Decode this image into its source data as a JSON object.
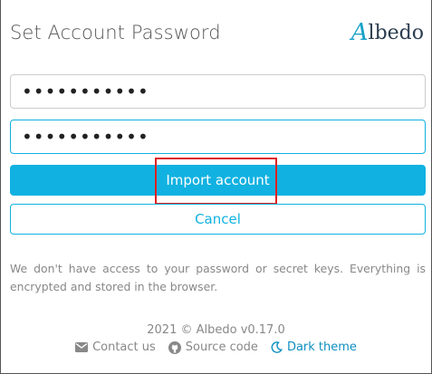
{
  "header": {
    "title": "Set Account Password",
    "logo": "Albedo",
    "logo_first": "A",
    "logo_rest": "lbedo"
  },
  "form": {
    "password_value": "•••••••••••",
    "confirm_value": "•••••••••••",
    "import_label": "Import account",
    "cancel_label": "Cancel"
  },
  "info_text": "We don't have access to your password or secret keys. Everything is encrypted and stored in the browser.",
  "footer": {
    "copyright": "2021 © Albedo v0.17.0",
    "contact_label": "Contact us",
    "source_label": "Source code",
    "theme_label": "Dark theme"
  },
  "colors": {
    "accent": "#11b2e1",
    "highlight": "#e02020"
  },
  "icons": {
    "contact": "envelope-icon",
    "source": "github-icon",
    "theme": "moon-icon"
  }
}
